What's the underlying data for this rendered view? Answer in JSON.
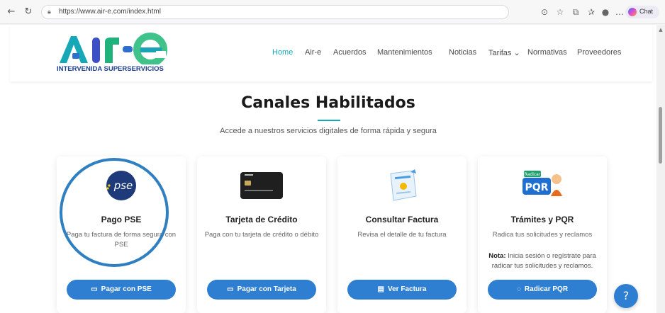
{
  "browser": {
    "url": "https://www.air-e.com/index.html",
    "chat_label": "Chat"
  },
  "site": {
    "logo_tagline": "INTERVENIDA SUPERSERVICIOS",
    "nav": [
      {
        "label": "Home"
      },
      {
        "label": "Air-e"
      },
      {
        "label": "Acuerdos"
      },
      {
        "label": "Mantenimientos"
      },
      {
        "label": "Noticias"
      },
      {
        "label": "Tarifas ⌄"
      },
      {
        "label": "Normativas"
      },
      {
        "label": "Proveedores"
      }
    ]
  },
  "section": {
    "title": "Canales Habilitados",
    "subtitle": "Accede a nuestros servicios digitales de forma rápida y segura"
  },
  "cards": [
    {
      "icon_label": "pse",
      "title": "Pago PSE",
      "desc": "Paga tu factura de forma segura con PSE",
      "button": "Pagar con PSE"
    },
    {
      "title": "Tarjeta de Crédito",
      "desc": "Paga con tu tarjeta de crédito o débito",
      "button": "Pagar con Tarjeta"
    },
    {
      "title": "Consultar Factura",
      "desc": "Revisa el detalle de tu factura",
      "button": "Ver Factura"
    },
    {
      "icon_top": "Radicar",
      "icon_label": "PQR",
      "title": "Trámites y PQR",
      "desc": "Radica tus solicitudes y reclamos",
      "note_label": "Nota:",
      "note_text": " Inicia sesión o regístrate para radicar tus solicitudes y reclamos.",
      "button": "Radicar PQR"
    }
  ],
  "help_icon": "?",
  "colors": {
    "accent": "#15a9b5",
    "button": "#2e7fd1",
    "ring": "#2f7fc1"
  }
}
